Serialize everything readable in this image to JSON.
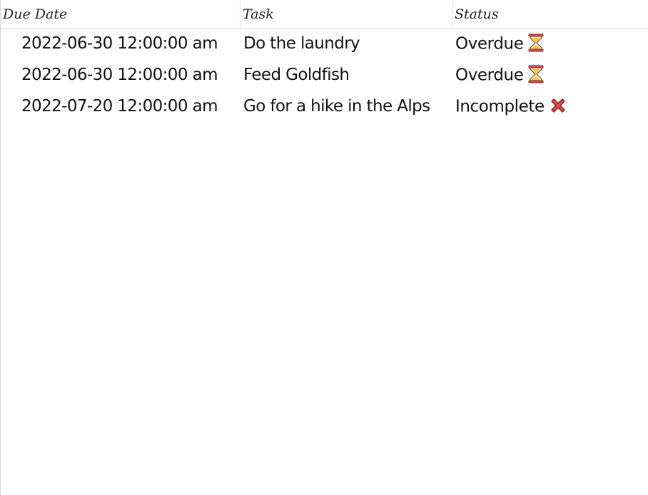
{
  "columns": {
    "due_date": "Due Date",
    "task": "Task",
    "status": "Status"
  },
  "rows": [
    {
      "due_date": "2022-06-30 12:00:00 am",
      "task": "Do the laundry",
      "status": "Overdue",
      "icon": "hourglass-icon"
    },
    {
      "due_date": "2022-06-30 12:00:00 am",
      "task": "Feed Goldfish",
      "status": "Overdue",
      "icon": "hourglass-icon"
    },
    {
      "due_date": "2022-07-20 12:00:00 am",
      "task": "Go for a hike in the Alps",
      "status": "Incomplete",
      "icon": "cross-mark-icon"
    }
  ],
  "colors": {
    "hourglass_frame": "#c0392b",
    "hourglass_sand": "#f5c542",
    "cross_mark": "#e74c3c"
  }
}
